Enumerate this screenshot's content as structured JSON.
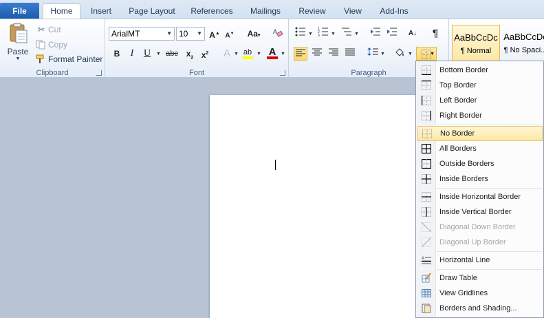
{
  "tabs": [
    {
      "label": "File"
    },
    {
      "label": "Home"
    },
    {
      "label": "Insert"
    },
    {
      "label": "Page Layout"
    },
    {
      "label": "References"
    },
    {
      "label": "Mailings"
    },
    {
      "label": "Review"
    },
    {
      "label": "View"
    },
    {
      "label": "Add-Ins"
    }
  ],
  "clipboard": {
    "label": "Clipboard",
    "paste": "Paste",
    "cut": "Cut",
    "copy": "Copy",
    "format_painter": "Format Painter"
  },
  "font": {
    "label": "Font",
    "font_name": "ArialMT",
    "font_size": "10"
  },
  "paragraph": {
    "label": "Paragraph"
  },
  "styles": [
    {
      "sample": "AaBbCcDc",
      "name": "¶ Normal"
    },
    {
      "sample": "AaBbCcDc",
      "name": "¶ No Spaci..."
    }
  ],
  "border_menu": {
    "items": [
      {
        "label": "Bottom Border",
        "icon": "bottom-border-icon",
        "disabled": false
      },
      {
        "label": "Top Border",
        "icon": "top-border-icon",
        "disabled": false
      },
      {
        "label": "Left Border",
        "icon": "left-border-icon",
        "disabled": false
      },
      {
        "label": "Right Border",
        "icon": "right-border-icon",
        "disabled": false
      },
      {
        "label": "No Border",
        "icon": "no-border-icon",
        "disabled": false,
        "highlighted": true
      },
      {
        "label": "All Borders",
        "icon": "all-borders-icon",
        "disabled": false
      },
      {
        "label": "Outside Borders",
        "icon": "outside-borders-icon",
        "disabled": false
      },
      {
        "label": "Inside Borders",
        "icon": "inside-borders-icon",
        "disabled": false
      },
      {
        "label": "Inside Horizontal Border",
        "icon": "inside-horizontal-border-icon",
        "disabled": false
      },
      {
        "label": "Inside Vertical Border",
        "icon": "inside-vertical-border-icon",
        "disabled": false
      },
      {
        "label": "Diagonal Down Border",
        "icon": "diagonal-down-border-icon",
        "disabled": true
      },
      {
        "label": "Diagonal Up Border",
        "icon": "diagonal-up-border-icon",
        "disabled": true
      },
      {
        "label": "Horizontal Line",
        "icon": "horizontal-line-icon",
        "disabled": false
      },
      {
        "label": "Draw Table",
        "icon": "draw-table-icon",
        "disabled": false
      },
      {
        "label": "View Gridlines",
        "icon": "view-gridlines-icon",
        "disabled": false
      },
      {
        "label": "Borders and Shading...",
        "icon": "borders-shading-icon",
        "disabled": false
      }
    ]
  },
  "colors": {
    "file_tab": "#2b6cc4",
    "highlight": "#fbd86e",
    "font_color_bar": "#e00000",
    "highlight_color_bar": "#ffff00"
  }
}
